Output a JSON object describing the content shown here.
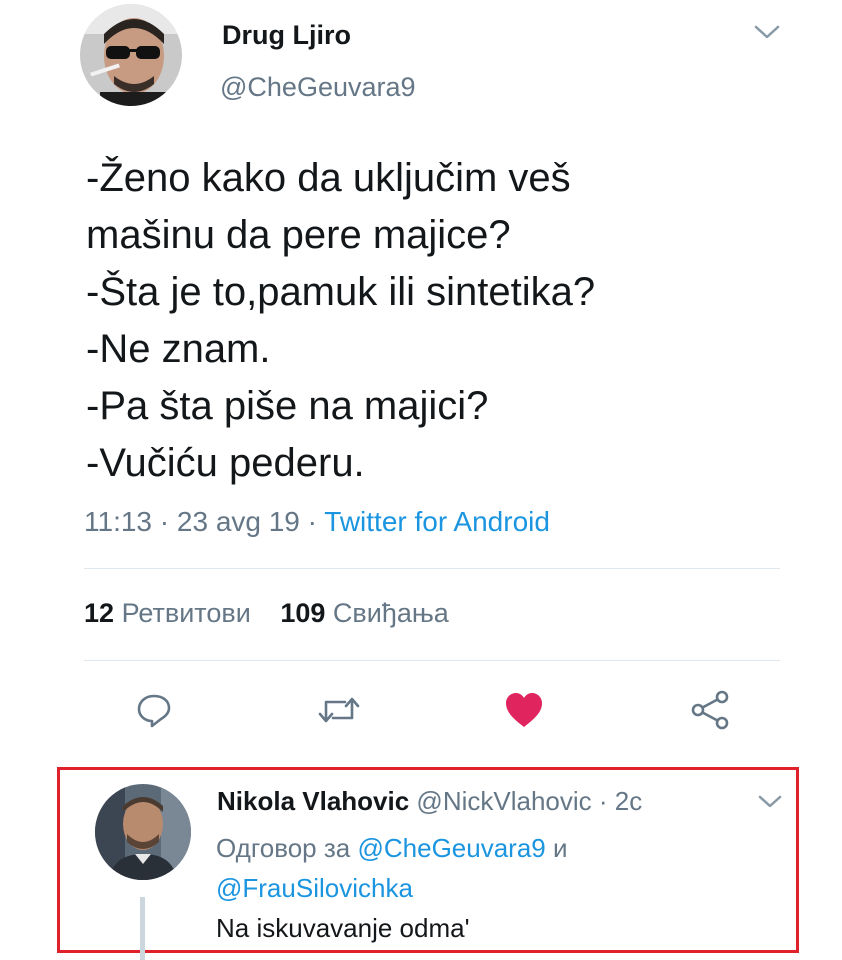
{
  "tweet": {
    "author_name": "Drug Ljiro",
    "author_handle": "@CheGeuvara9",
    "text_lines": [
      "-Ženo kako da uključim veš",
      "mašinu da pere majice?",
      "-Šta je to,pamuk ili sintetika?",
      "-Ne znam.",
      "-Pa šta piše na majici?",
      "-Vučiću pederu."
    ],
    "time": "11:13",
    "date": "23 avg 19",
    "separator": "·",
    "source": "Twitter for Android",
    "retweets_count": "12",
    "retweets_label": "Ретвитови",
    "likes_count": "109",
    "likes_label": "Свиђања"
  },
  "actions": {
    "reply_icon": "reply-bubble-icon",
    "retweet_icon": "retweet-icon",
    "like_icon": "heart-icon",
    "share_icon": "share-icon",
    "like_color": "#e0245e"
  },
  "reply": {
    "author_name": "Nikola Vlahovic",
    "author_handle": "@NickVlahovic",
    "separator": "·",
    "age": "2с",
    "reply_prefix": "Одговор за",
    "mention_1": "@CheGeuvara9",
    "conjunction": "и",
    "mention_2": "@FrauSilovichka",
    "text": "Na iskuvavanje odma'",
    "highlight_color": "#e0202b"
  }
}
